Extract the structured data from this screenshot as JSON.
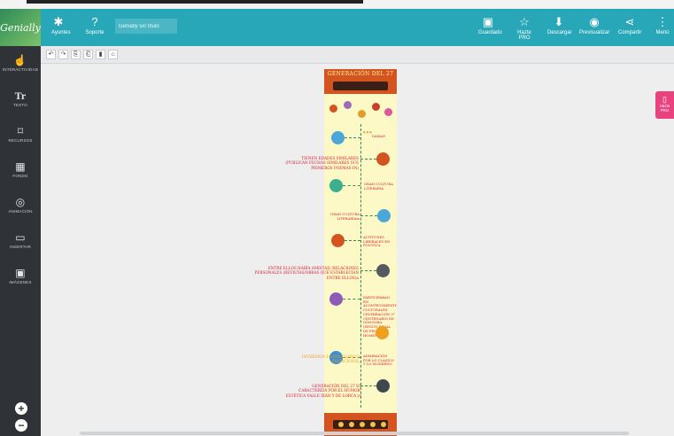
{
  "app": {
    "logo": "Genially"
  },
  "header": {
    "title_value": "Genially sin título",
    "help": "Ayuntes",
    "support": "Soporte",
    "saved": "Guardado",
    "pro": "Hazte PRO",
    "download": "Descargar",
    "preview": "Previsualizar",
    "share": "Compartir",
    "menu": "Menú"
  },
  "sidebar": {
    "items": [
      "INTERACTIVIDAD",
      "TEXTO",
      "RECURSOS",
      "FONDO",
      "ANIMACIÓN",
      "INSERTAR",
      "IMÁGENES"
    ]
  },
  "toolbar": {
    "undo": "↶",
    "redo": "↷",
    "copy": "⎘",
    "paste": "⎗",
    "delete": "🗑",
    "lock": "🔒"
  },
  "poster": {
    "title": "GENERACIÓN DEL 27",
    "entries": [
      {
        "text": "DAMAS"
      },
      {
        "text": "TIENEN EDADES SIMILARES (PUBLICAN FECHAS SIMILARES SUS PRIMEROS POEMAS-IN)"
      },
      {
        "text": "GRAN CULTURA LITERARIA"
      },
      {
        "text": "GRAN CULTURA LITERARIAin"
      },
      {
        "text": "ACTITUDES LIBERALES EN POLITICA"
      },
      {
        "text": "ENTRE ELLOS HABÍA AMISTAD, RELACIONES PERSONALES (REVISTAS/OBRAS QUE ESTABLECIAN ENTRE ELLOS)a"
      },
      {
        "text": "PARTICIPABAN EN ACONTECIMIENTOS CULTURALES CELEBRACIÓN 3° CENTENARIO DE GÓNGORA (SEGUN RIMAL DE FECHAS HOMENAJE)"
      },
      {
        "text": "INVERSIÓN LO FOLKLÓRICO TRADICIONAL"
      },
      {
        "text": "ADMIRACIÓN POR LO CLÁSICO Y LO MODERNO"
      },
      {
        "text": "GENERACIÓN DEL 27 ES CARACTERIZA POR EL HUMOR. ESTÉTICA VALLE IXAN Y DE LORCA ys"
      }
    ]
  },
  "side_tab": {
    "label": "Hazte PRO"
  },
  "colors": {
    "header": "#27a7b7",
    "sidebar": "#2f3337",
    "poster_bg": "#fdf9c7",
    "poster_band": "#d4541f",
    "accent_text": "#d41c2c"
  }
}
